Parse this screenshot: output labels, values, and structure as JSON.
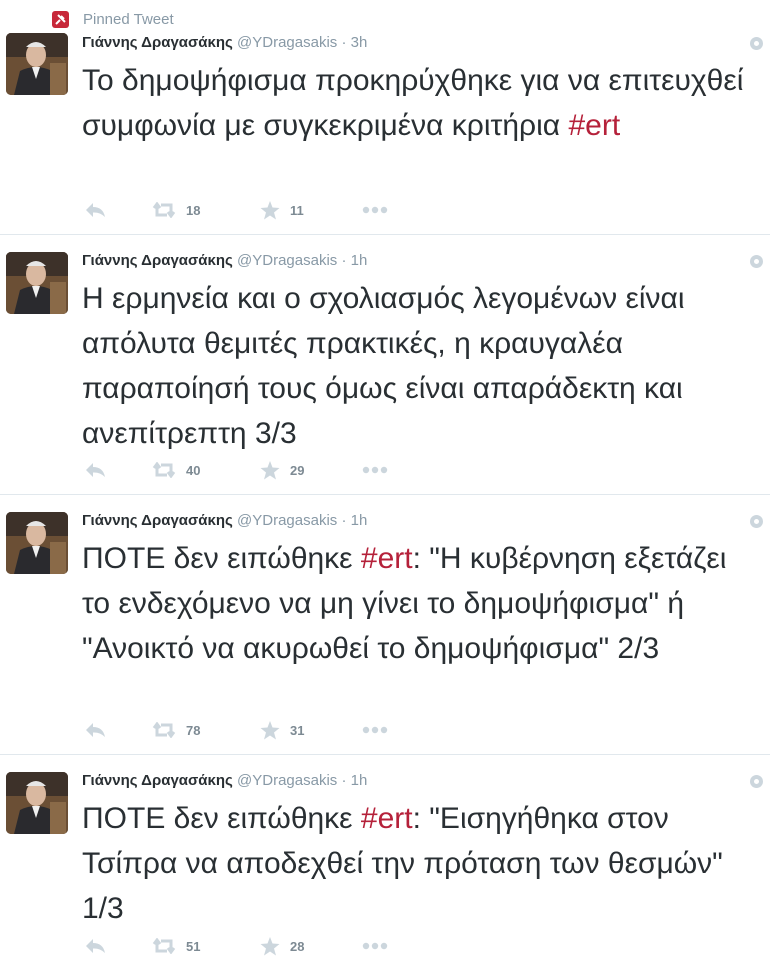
{
  "pinned": {
    "label": "Pinned Tweet"
  },
  "tweets": [
    {
      "author": "Γιάννης Δραγασάκης",
      "handle": "@YDragasakis",
      "separator": "·",
      "time": "3h",
      "parts": {
        "a": "Το δημοψήφισμα προκηρύχθηκε για να επιτευχθεί συμφωνία με συγκεκριμένα κριτήρια ",
        "tag": "#ert",
        "b": ""
      },
      "retweets": "18",
      "favorites": "11"
    },
    {
      "author": "Γιάννης Δραγασάκης",
      "handle": "@YDragasakis",
      "separator": "·",
      "time": "1h",
      "parts": {
        "a": "Η ερμηνεία και ο σχολιασμός λεγομένων είναι απόλυτα θεμιτές πρακτικές, η κραυγαλέα παραποίησή τους όμως είναι απαράδεκτη και ανεπίτρεπτη 3/3",
        "tag": "",
        "b": ""
      },
      "retweets": "40",
      "favorites": "29"
    },
    {
      "author": "Γιάννης Δραγασάκης",
      "handle": "@YDragasakis",
      "separator": "·",
      "time": "1h",
      "parts": {
        "a": "ΠΟΤΕ δεν ειπώθηκε ",
        "tag": "#ert",
        "b": ": \"Η κυβέρνηση εξετάζει το ενδεχόμενο να μη γίνει το δημοψήφισμα\" ή \"Ανοικτό να ακυρωθεί το δημοψήφισμα\" 2/3"
      },
      "retweets": "78",
      "favorites": "31"
    },
    {
      "author": "Γιάννης Δραγασάκης",
      "handle": "@YDragasakis",
      "separator": "·",
      "time": "1h",
      "parts": {
        "a": "ΠΟΤΕ δεν ειπώθηκε ",
        "tag": "#ert",
        "b": ": \"Εισηγήθηκα στον Τσίπρα να αποδεχθεί την πρόταση των θεσμών\" 1/3"
      },
      "retweets": "51",
      "favorites": "28"
    }
  ],
  "colors": {
    "hashtag": "#b5213a",
    "muted": "#8899a6",
    "pin": "#c7283a",
    "text": "#292f33"
  },
  "icons": {
    "pin": "pin-icon",
    "reply": "reply-icon",
    "retweet": "retweet-icon",
    "favorite": "star-icon",
    "more": "more-icon",
    "settings": "gear-icon"
  }
}
